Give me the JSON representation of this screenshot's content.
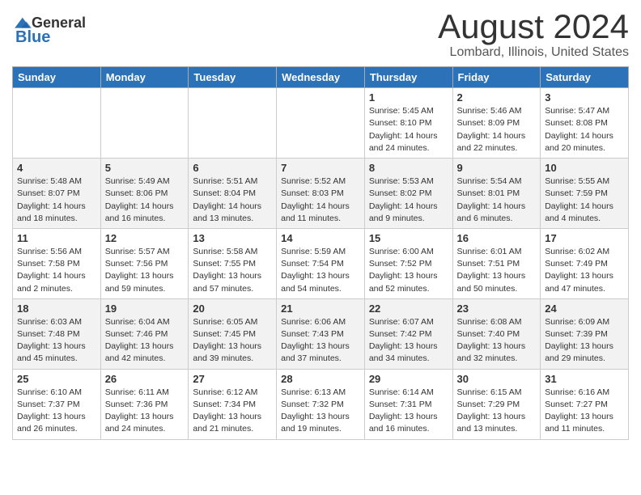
{
  "logo": {
    "general": "General",
    "blue": "Blue",
    "line2": "Blue"
  },
  "title": "August 2024",
  "location": "Lombard, Illinois, United States",
  "days_header": [
    "Sunday",
    "Monday",
    "Tuesday",
    "Wednesday",
    "Thursday",
    "Friday",
    "Saturday"
  ],
  "weeks": [
    [
      {
        "day": "",
        "info": ""
      },
      {
        "day": "",
        "info": ""
      },
      {
        "day": "",
        "info": ""
      },
      {
        "day": "",
        "info": ""
      },
      {
        "day": "1",
        "info": "Sunrise: 5:45 AM\nSunset: 8:10 PM\nDaylight: 14 hours\nand 24 minutes."
      },
      {
        "day": "2",
        "info": "Sunrise: 5:46 AM\nSunset: 8:09 PM\nDaylight: 14 hours\nand 22 minutes."
      },
      {
        "day": "3",
        "info": "Sunrise: 5:47 AM\nSunset: 8:08 PM\nDaylight: 14 hours\nand 20 minutes."
      }
    ],
    [
      {
        "day": "4",
        "info": "Sunrise: 5:48 AM\nSunset: 8:07 PM\nDaylight: 14 hours\nand 18 minutes."
      },
      {
        "day": "5",
        "info": "Sunrise: 5:49 AM\nSunset: 8:06 PM\nDaylight: 14 hours\nand 16 minutes."
      },
      {
        "day": "6",
        "info": "Sunrise: 5:51 AM\nSunset: 8:04 PM\nDaylight: 14 hours\nand 13 minutes."
      },
      {
        "day": "7",
        "info": "Sunrise: 5:52 AM\nSunset: 8:03 PM\nDaylight: 14 hours\nand 11 minutes."
      },
      {
        "day": "8",
        "info": "Sunrise: 5:53 AM\nSunset: 8:02 PM\nDaylight: 14 hours\nand 9 minutes."
      },
      {
        "day": "9",
        "info": "Sunrise: 5:54 AM\nSunset: 8:01 PM\nDaylight: 14 hours\nand 6 minutes."
      },
      {
        "day": "10",
        "info": "Sunrise: 5:55 AM\nSunset: 7:59 PM\nDaylight: 14 hours\nand 4 minutes."
      }
    ],
    [
      {
        "day": "11",
        "info": "Sunrise: 5:56 AM\nSunset: 7:58 PM\nDaylight: 14 hours\nand 2 minutes."
      },
      {
        "day": "12",
        "info": "Sunrise: 5:57 AM\nSunset: 7:56 PM\nDaylight: 13 hours\nand 59 minutes."
      },
      {
        "day": "13",
        "info": "Sunrise: 5:58 AM\nSunset: 7:55 PM\nDaylight: 13 hours\nand 57 minutes."
      },
      {
        "day": "14",
        "info": "Sunrise: 5:59 AM\nSunset: 7:54 PM\nDaylight: 13 hours\nand 54 minutes."
      },
      {
        "day": "15",
        "info": "Sunrise: 6:00 AM\nSunset: 7:52 PM\nDaylight: 13 hours\nand 52 minutes."
      },
      {
        "day": "16",
        "info": "Sunrise: 6:01 AM\nSunset: 7:51 PM\nDaylight: 13 hours\nand 50 minutes."
      },
      {
        "day": "17",
        "info": "Sunrise: 6:02 AM\nSunset: 7:49 PM\nDaylight: 13 hours\nand 47 minutes."
      }
    ],
    [
      {
        "day": "18",
        "info": "Sunrise: 6:03 AM\nSunset: 7:48 PM\nDaylight: 13 hours\nand 45 minutes."
      },
      {
        "day": "19",
        "info": "Sunrise: 6:04 AM\nSunset: 7:46 PM\nDaylight: 13 hours\nand 42 minutes."
      },
      {
        "day": "20",
        "info": "Sunrise: 6:05 AM\nSunset: 7:45 PM\nDaylight: 13 hours\nand 39 minutes."
      },
      {
        "day": "21",
        "info": "Sunrise: 6:06 AM\nSunset: 7:43 PM\nDaylight: 13 hours\nand 37 minutes."
      },
      {
        "day": "22",
        "info": "Sunrise: 6:07 AM\nSunset: 7:42 PM\nDaylight: 13 hours\nand 34 minutes."
      },
      {
        "day": "23",
        "info": "Sunrise: 6:08 AM\nSunset: 7:40 PM\nDaylight: 13 hours\nand 32 minutes."
      },
      {
        "day": "24",
        "info": "Sunrise: 6:09 AM\nSunset: 7:39 PM\nDaylight: 13 hours\nand 29 minutes."
      }
    ],
    [
      {
        "day": "25",
        "info": "Sunrise: 6:10 AM\nSunset: 7:37 PM\nDaylight: 13 hours\nand 26 minutes."
      },
      {
        "day": "26",
        "info": "Sunrise: 6:11 AM\nSunset: 7:36 PM\nDaylight: 13 hours\nand 24 minutes."
      },
      {
        "day": "27",
        "info": "Sunrise: 6:12 AM\nSunset: 7:34 PM\nDaylight: 13 hours\nand 21 minutes."
      },
      {
        "day": "28",
        "info": "Sunrise: 6:13 AM\nSunset: 7:32 PM\nDaylight: 13 hours\nand 19 minutes."
      },
      {
        "day": "29",
        "info": "Sunrise: 6:14 AM\nSunset: 7:31 PM\nDaylight: 13 hours\nand 16 minutes."
      },
      {
        "day": "30",
        "info": "Sunrise: 6:15 AM\nSunset: 7:29 PM\nDaylight: 13 hours\nand 13 minutes."
      },
      {
        "day": "31",
        "info": "Sunrise: 6:16 AM\nSunset: 7:27 PM\nDaylight: 13 hours\nand 11 minutes."
      }
    ]
  ]
}
